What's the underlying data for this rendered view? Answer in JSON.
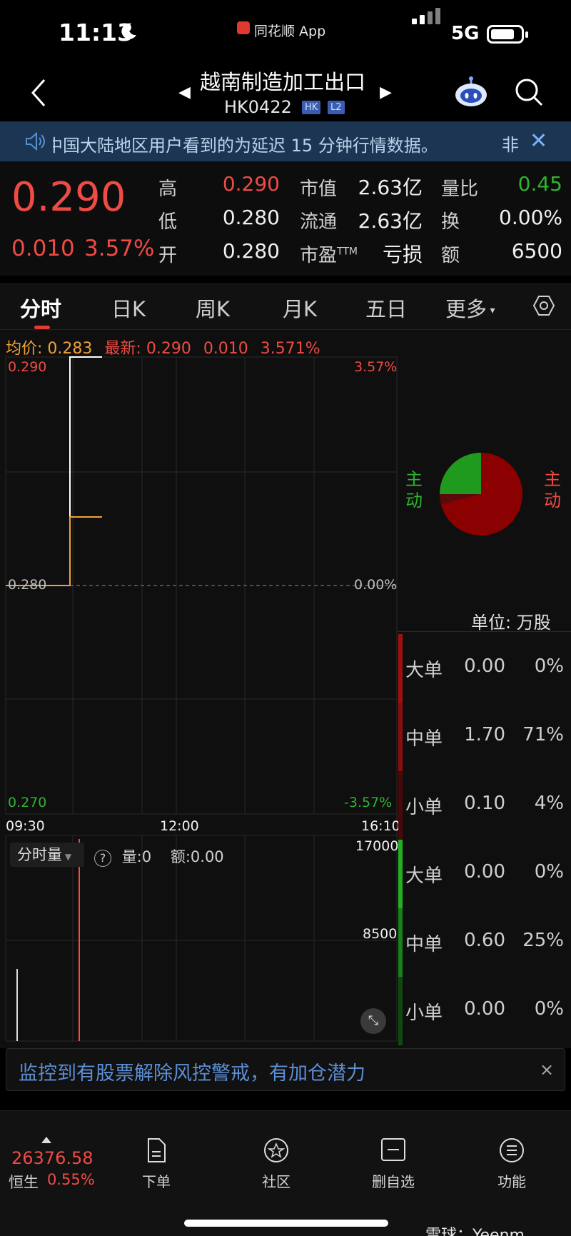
{
  "status": {
    "time": "11:13",
    "app": "同花顺 App",
    "network": "5G"
  },
  "header": {
    "title": "越南制造加工出口",
    "code": "HK0422",
    "tags": [
      "HK",
      "L2"
    ],
    "prev": "◀",
    "next": "▶"
  },
  "notice": {
    "text": "中国大陆地区用户看到的为延迟 15 分钟行情数据。",
    "more": "非",
    "close": "✕"
  },
  "quote": {
    "price": "0.290",
    "change": "0.010",
    "change_pct": "3.57%",
    "high_label": "高",
    "high": "0.290",
    "low_label": "低",
    "low": "0.280",
    "open_label": "开",
    "open": "0.280",
    "mcap_label": "市值",
    "mcap": "2.63亿",
    "float_label": "流通",
    "float": "2.63亿",
    "pe_label": "市盈",
    "pe_sup": "TTM",
    "pe": "亏损",
    "vr_label": "量比",
    "vr": "0.45",
    "turn_label": "换",
    "turn": "0.00%",
    "amt_label": "额",
    "amt": "6500"
  },
  "tabs": [
    "分时",
    "日K",
    "周K",
    "月K",
    "五日",
    "更多"
  ],
  "chart": {
    "avg_label": "均价:",
    "avg": "0.283",
    "latest_label": "最新:",
    "latest": "0.290",
    "latest_chg": "0.010",
    "latest_pct": "3.571%",
    "y_top": "0.290",
    "y_mid": "0.280",
    "y_bot": "0.270",
    "pct_top": "3.57%",
    "pct_mid": "0.00%",
    "pct_bot": "-3.57%",
    "x_start": "09:30",
    "x_mid": "12:00",
    "x_end": "16:10",
    "vol_selector": "分时量",
    "vol_label": "量:",
    "vol": "0",
    "amt_label": "额:",
    "amt": "0.00",
    "vol_top": "17000",
    "vol_mid": "8500"
  },
  "chart_data": {
    "type": "line",
    "title": "",
    "x": [
      "09:30",
      "09:50",
      "09:50",
      "10:00"
    ],
    "series": [
      {
        "values": [
          0.28,
          0.28,
          0.29,
          0.29
        ]
      },
      {
        "values": [
          0.28,
          0.28,
          0.283,
          0.283
        ]
      }
    ],
    "ylim": [
      0.27,
      0.29
    ],
    "xlabel": "",
    "ylabel": ""
  },
  "flow": {
    "pie_left": "主动",
    "pie_right": "主动",
    "unit_label": "单位:",
    "unit": "万股",
    "rows": [
      {
        "name": "大单",
        "vol": "0.00",
        "pct": "0%",
        "side": "buy"
      },
      {
        "name": "中单",
        "vol": "1.70",
        "pct": "71%",
        "side": "buy"
      },
      {
        "name": "小单",
        "vol": "0.10",
        "pct": "4%",
        "side": "buy"
      },
      {
        "name": "大单",
        "vol": "0.00",
        "pct": "0%",
        "side": "sell"
      },
      {
        "name": "中单",
        "vol": "0.60",
        "pct": "25%",
        "side": "sell"
      },
      {
        "name": "小单",
        "vol": "0.00",
        "pct": "0%",
        "side": "sell"
      }
    ],
    "pie": {
      "buy_share": 0.75,
      "sell_share": 0.25,
      "colors": {
        "buy": "#8b0000",
        "sell": "#1f9a1f"
      }
    }
  },
  "alert": {
    "text": "监控到有股票解除风控警戒，有加仓潜力",
    "close": "×"
  },
  "bottom": {
    "index_value": "26376.58",
    "index_name": "恒生",
    "index_pct": "0.55%",
    "nav": [
      "下单",
      "社区",
      "删自选",
      "功能"
    ],
    "watermark": "雪球：Yeenm"
  },
  "colors": {
    "up": "#ef4b45",
    "down": "#2fb32f",
    "avg": "#f0a23a"
  }
}
